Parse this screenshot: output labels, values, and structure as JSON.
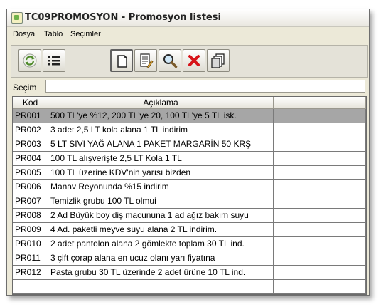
{
  "window": {
    "title": "TC09PROMOSYON - Promosyon listesi"
  },
  "menu": {
    "items": [
      "Dosya",
      "Tablo",
      "Seçimler"
    ]
  },
  "toolbar": {
    "buttons": [
      "refresh-icon",
      "list-view-icon",
      "new-record-icon",
      "edit-record-icon",
      "search-icon",
      "delete-icon",
      "copy-icon"
    ]
  },
  "selection": {
    "label": "Seçim",
    "value": ""
  },
  "grid": {
    "columns": [
      "Kod",
      "Açıklama",
      ""
    ],
    "rows": [
      {
        "code": "PR001",
        "description": "500 TL'ye %12, 200 TL'ye 20, 100 TL'ye 5 TL isk.",
        "selected": true
      },
      {
        "code": "PR002",
        "description": "3 adet 2,5 LT kola alana  1 TL indirim"
      },
      {
        "code": "PR003",
        "description": "5 LT SIVI YAĞ ALANA 1 PAKET MARGARİN 50 KRŞ"
      },
      {
        "code": "PR004",
        "description": "100 TL alışverişte 2,5 LT Kola 1 TL"
      },
      {
        "code": "PR005",
        "description": "100 TL üzerine KDV'nin yarısı bizden"
      },
      {
        "code": "PR006",
        "description": "Manav Reyonunda %15 indirim"
      },
      {
        "code": "PR007",
        "description": "Temizlik grubu 100 TL olmui"
      },
      {
        "code": "PR008",
        "description": "2 Ad Büyük boy diş macununa 1 ad ağız bakım suyu"
      },
      {
        "code": "PR009",
        "description": "4 Ad. paketli meyve suyu alana 2 TL indirim."
      },
      {
        "code": "PR010",
        "description": "2 adet pantolon alana 2 gömlekte toplam 30 TL ind."
      },
      {
        "code": "PR011",
        "description": "3 çift çorap alana en ucuz olanı yarı fiyatına"
      },
      {
        "code": "PR012",
        "description": "Pasta grubu 30 TL üzerinde 2 adet ürüne 10 TL ind."
      },
      {
        "code": "",
        "description": ""
      }
    ]
  }
}
